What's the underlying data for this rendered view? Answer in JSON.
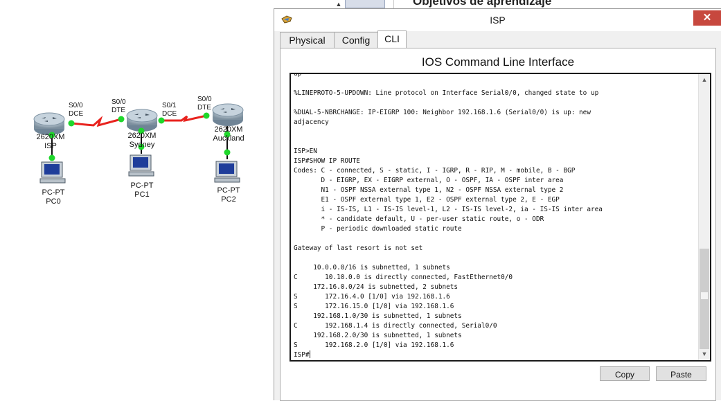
{
  "background": {
    "heading": "Objetivos de aprendizaje",
    "scroll_glyph": "▲"
  },
  "topology": {
    "devices": [
      {
        "id": "isp",
        "model": "2620XM",
        "name": "ISP"
      },
      {
        "id": "sydney",
        "model": "2620XM",
        "name": "Sydney"
      },
      {
        "id": "auckland",
        "model": "2620XM",
        "name": "Auckland"
      },
      {
        "id": "pc0",
        "model": "PC-PT",
        "name": "PC0"
      },
      {
        "id": "pc1",
        "model": "PC-PT",
        "name": "PC1"
      },
      {
        "id": "pc2",
        "model": "PC-PT",
        "name": "PC2"
      }
    ],
    "ports": {
      "isp_s00": "S0/0",
      "isp_s00_role": "DCE",
      "syd_s00": "S0/0",
      "syd_s00_role": "DTE",
      "syd_s01": "S0/1",
      "syd_s01_role": "DCE",
      "akl_s00": "S0/0",
      "akl_s00_role": "DTE"
    },
    "link_color": "#e8231e",
    "link_light_color": "#1fd72c"
  },
  "window": {
    "title": "ISP",
    "close_glyph": "✕",
    "tabs": [
      {
        "label": "Physical",
        "active": false
      },
      {
        "label": "Config",
        "active": false
      },
      {
        "label": "CLI",
        "active": true
      }
    ],
    "panel_title": "IOS Command Line Interface",
    "terminal_lines": [
      "up",
      "",
      "%LINEPROTO-5-UPDOWN: Line protocol on Interface Serial0/0, changed state to up",
      "",
      "%DUAL-5-NBRCHANGE: IP-EIGRP 100: Neighbor 192.168.1.6 (Serial0/0) is up: new",
      "adjacency",
      "",
      "",
      "ISP>EN",
      "ISP#SHOW IP ROUTE",
      "Codes: C - connected, S - static, I - IGRP, R - RIP, M - mobile, B - BGP",
      "       D - EIGRP, EX - EIGRP external, O - OSPF, IA - OSPF inter area",
      "       N1 - OSPF NSSA external type 1, N2 - OSPF NSSA external type 2",
      "       E1 - OSPF external type 1, E2 - OSPF external type 2, E - EGP",
      "       i - IS-IS, L1 - IS-IS level-1, L2 - IS-IS level-2, ia - IS-IS inter area",
      "       * - candidate default, U - per-user static route, o - ODR",
      "       P - periodic downloaded static route",
      "",
      "Gateway of last resort is not set",
      "",
      "     10.0.0.0/16 is subnetted, 1 subnets",
      "C       10.10.0.0 is directly connected, FastEthernet0/0",
      "     172.16.0.0/24 is subnetted, 2 subnets",
      "S       172.16.4.0 [1/0] via 192.168.1.6",
      "S       172.16.15.0 [1/0] via 192.168.1.6",
      "     192.168.1.0/30 is subnetted, 1 subnets",
      "C       192.168.1.4 is directly connected, Serial0/0",
      "     192.168.2.0/30 is subnetted, 1 subnets",
      "S       192.168.2.0 [1/0] via 192.168.1.6"
    ],
    "prompt": "ISP#",
    "scroll_up_glyph": "▲",
    "scroll_down_glyph": "▼",
    "copy_label": "Copy",
    "paste_label": "Paste"
  }
}
